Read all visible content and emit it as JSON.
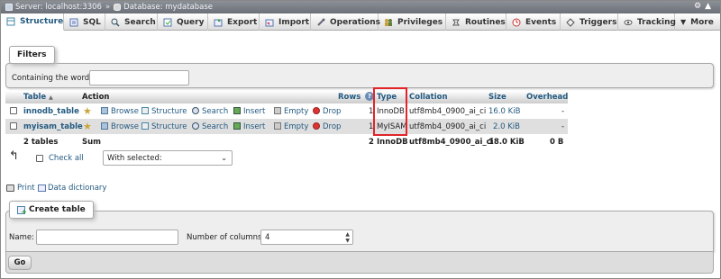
{
  "breadcrumb": {
    "server": "Server: localhost:3306",
    "database": "Database: mydatabase"
  },
  "tabs": [
    {
      "label": "Structure",
      "icon": "structure-icon",
      "active": true
    },
    {
      "label": "SQL",
      "icon": "sql-icon"
    },
    {
      "label": "Search",
      "icon": "search-icon"
    },
    {
      "label": "Query",
      "icon": "query-icon"
    },
    {
      "label": "Export",
      "icon": "export-icon"
    },
    {
      "label": "Import",
      "icon": "import-icon"
    },
    {
      "label": "Operations",
      "icon": "operations-icon"
    },
    {
      "label": "Privileges",
      "icon": "privileges-icon"
    },
    {
      "label": "Routines",
      "icon": "routines-icon"
    },
    {
      "label": "Events",
      "icon": "events-icon"
    },
    {
      "label": "Triggers",
      "icon": "triggers-icon"
    },
    {
      "label": "Tracking",
      "icon": "tracking-icon"
    },
    {
      "label": "More",
      "icon": "more-icon"
    }
  ],
  "filters": {
    "legend": "Filters",
    "label": "Containing the word:",
    "value": ""
  },
  "table": {
    "headers": {
      "table": "Table",
      "action": "Action",
      "rows": "Rows",
      "type": "Type",
      "collation": "Collation",
      "size": "Size",
      "overhead": "Overhead"
    },
    "actions": [
      "Browse",
      "Structure",
      "Search",
      "Insert",
      "Empty",
      "Drop"
    ],
    "rows": [
      {
        "name": "innodb_table",
        "rows": "1",
        "type": "InnoDB",
        "collation": "utf8mb4_0900_ai_ci",
        "size": "16.0 KiB",
        "overhead": "-"
      },
      {
        "name": "myisam_table",
        "rows": "1",
        "type": "MyISAM",
        "collation": "utf8mb4_0900_ai_ci",
        "size": "2.0 KiB",
        "overhead": "-"
      }
    ],
    "summary": {
      "name": "2 tables",
      "label": "Sum",
      "rows": "2",
      "type": "InnoDB",
      "collation": "utf8mb4_0900_ai_ci",
      "size": "18.0 KiB",
      "overhead": "0 B"
    }
  },
  "bulk": {
    "check_all": "Check all",
    "with_selected": "With selected:"
  },
  "links": {
    "print": "Print",
    "dictionary": "Data dictionary"
  },
  "create_table": {
    "legend": "Create table",
    "name_label": "Name:",
    "name_value": "",
    "columns_label": "Number of columns:",
    "columns_value": "4",
    "go": "Go"
  },
  "colors": {
    "link": "#235a81",
    "highlight": "#e0252b",
    "tabbar": "#dcdcdc"
  }
}
